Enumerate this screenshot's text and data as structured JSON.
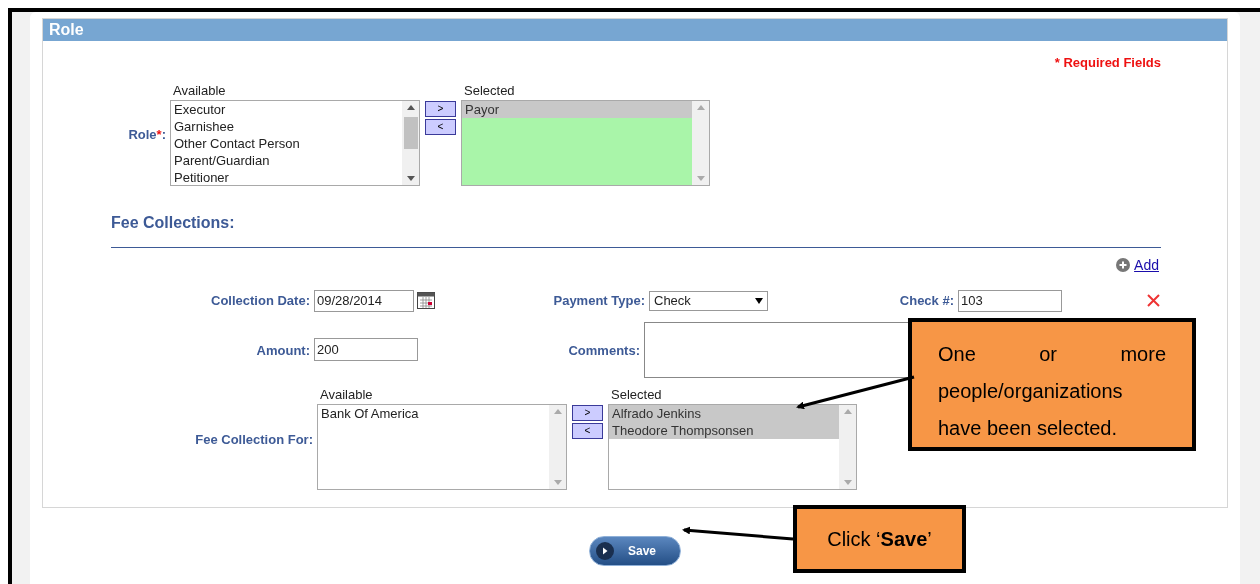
{
  "section": {
    "title": "Role"
  },
  "required_note": "* Required Fields",
  "role": {
    "label": "Role",
    "required_mark": "*",
    "colon": ":",
    "available": {
      "label": "Available",
      "options": [
        {
          "text": "Executor",
          "selected": false
        },
        {
          "text": "Garnishee",
          "selected": false
        },
        {
          "text": "Other Contact Person",
          "selected": false
        },
        {
          "text": "Parent/Guardian",
          "selected": false
        },
        {
          "text": "Petitioner",
          "selected": false
        }
      ]
    },
    "move_buttons": [
      ">",
      "<"
    ],
    "selected": {
      "label": "Selected",
      "valid": true,
      "options": [
        {
          "text": "Payor",
          "selected": true
        }
      ]
    }
  },
  "fee_collections": {
    "title": "Fee Collections:",
    "add_link": "Add",
    "collection_date": {
      "label": "Collection Date:",
      "value": "09/28/2014"
    },
    "payment_type": {
      "label": "Payment Type:",
      "value": "Check"
    },
    "check_number": {
      "label": "Check #:",
      "value": "103"
    },
    "amount": {
      "label": "Amount:",
      "value": "200"
    },
    "comments": {
      "label": "Comments:"
    },
    "fee_collection_for": {
      "label": "Fee Collection For:",
      "available": {
        "label": "Available",
        "options": [
          {
            "text": "Bank Of America",
            "selected": false
          }
        ]
      },
      "move_buttons": [
        ">",
        "<"
      ],
      "selected": {
        "label": "Selected",
        "valid": false,
        "options": [
          {
            "text": "Alfrado Jenkins",
            "selected": true
          },
          {
            "text": "Theodore Thompsonsen",
            "selected": true
          }
        ]
      }
    }
  },
  "save_button": "Save",
  "callouts": [
    {
      "text": "One or more people/organizations have been selected."
    },
    {
      "text": "Click ‘**Save**’"
    }
  ]
}
